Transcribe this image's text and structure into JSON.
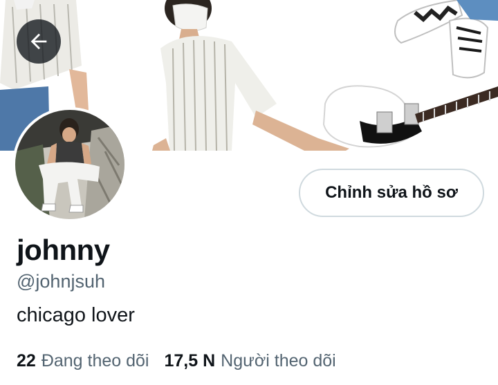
{
  "header": {
    "back_icon": "arrow-left-icon",
    "banner_description": "banner photo"
  },
  "profile": {
    "avatar_alt": "avatar",
    "edit_button_label": "Chỉnh sửa hồ sơ",
    "name": "johnny",
    "handle": "@johnjsuh",
    "bio": "chicago lover"
  },
  "stats": {
    "following_count": "22",
    "following_label": "Đang theo dõi",
    "followers_count": "17,5 N",
    "followers_label": "Người theo dõi"
  },
  "colors": {
    "text_primary": "#0f1419",
    "text_secondary": "#536471",
    "button_border": "#cfd9de"
  }
}
